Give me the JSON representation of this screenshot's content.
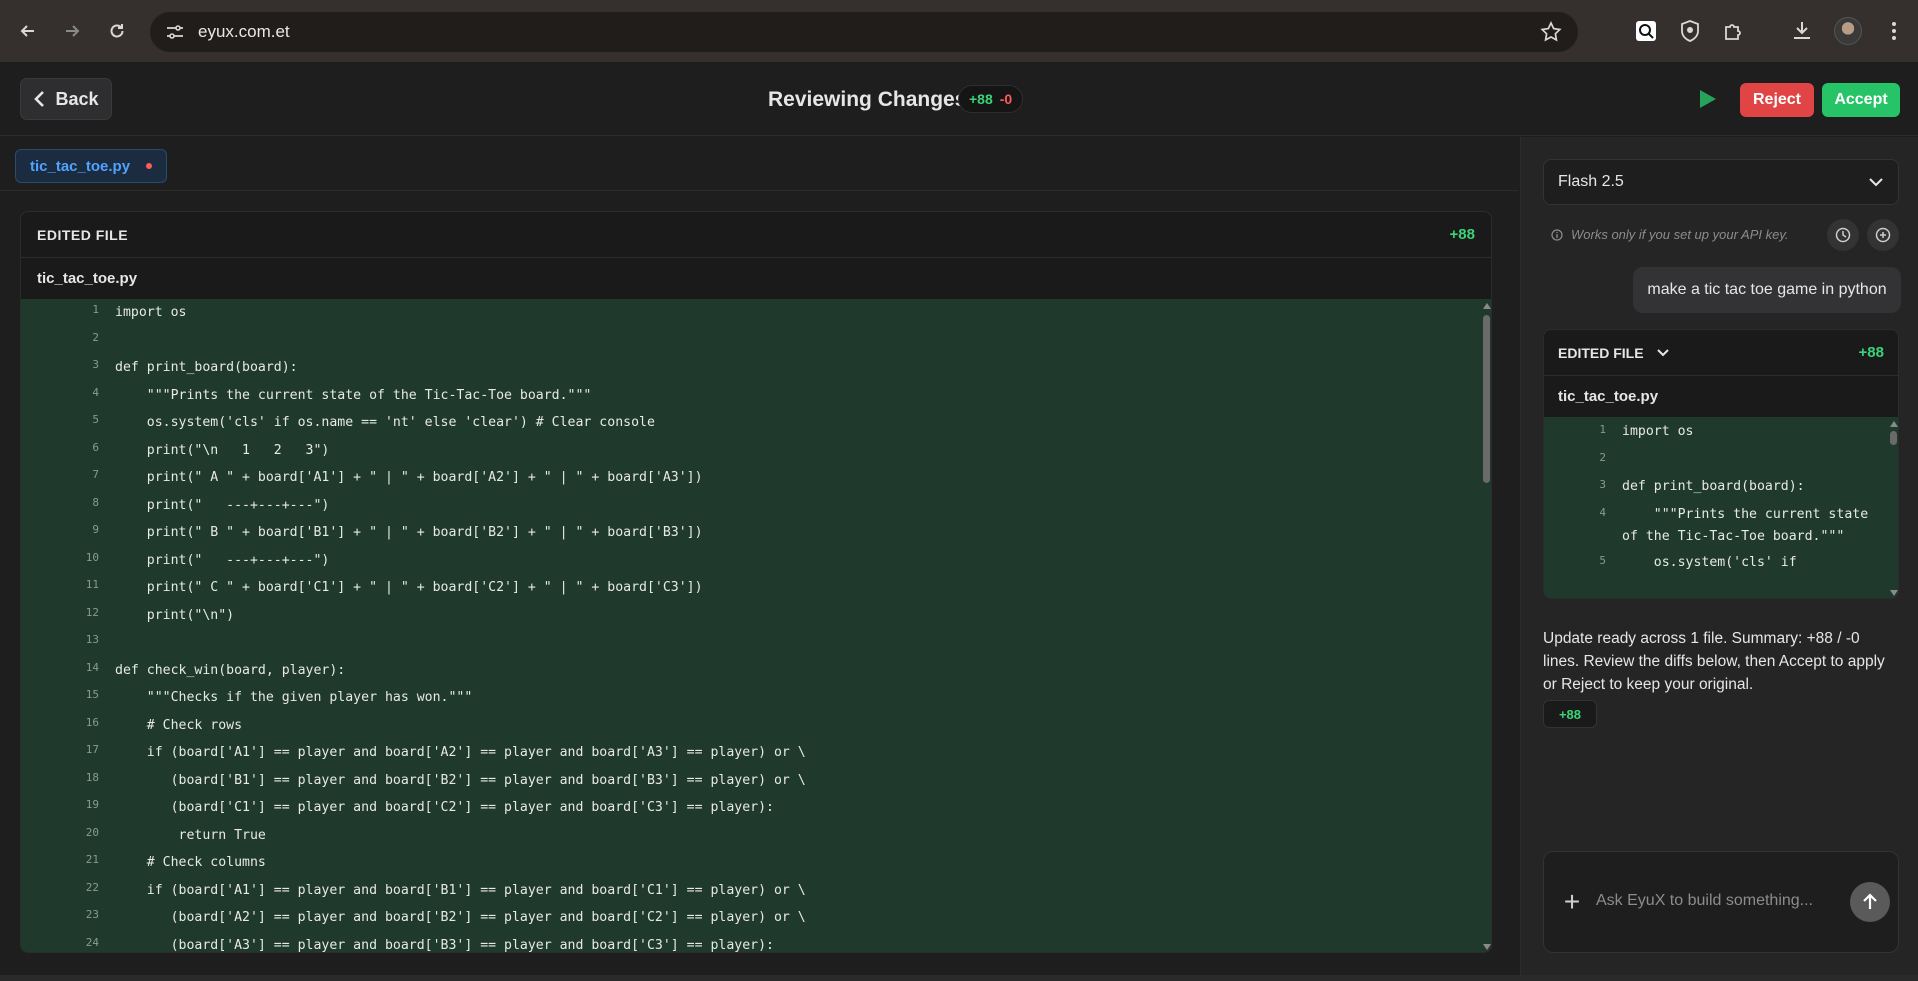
{
  "browser": {
    "url": "eyux.com.et"
  },
  "header": {
    "back_label": "Back",
    "title": "Reviewing Changes",
    "added": "+88",
    "removed": "-0",
    "reject_label": "Reject",
    "accept_label": "Accept"
  },
  "editor": {
    "tab_name": "tic_tac_toe.py",
    "card_label": "EDITED FILE",
    "card_count": "+88",
    "file_name": "tic_tac_toe.py",
    "lines": [
      {
        "n": "1",
        "code": "import os"
      },
      {
        "n": "2",
        "code": ""
      },
      {
        "n": "3",
        "code": "def print_board(board):"
      },
      {
        "n": "4",
        "code": "    \"\"\"Prints the current state of the Tic-Tac-Toe board.\"\"\""
      },
      {
        "n": "5",
        "code": "    os.system('cls' if os.name == 'nt' else 'clear') # Clear console"
      },
      {
        "n": "6",
        "code": "    print(\"\\n   1   2   3\")"
      },
      {
        "n": "7",
        "code": "    print(\" A \" + board['A1'] + \" | \" + board['A2'] + \" | \" + board['A3'])"
      },
      {
        "n": "8",
        "code": "    print(\"   ---+---+---\")"
      },
      {
        "n": "9",
        "code": "    print(\" B \" + board['B1'] + \" | \" + board['B2'] + \" | \" + board['B3'])"
      },
      {
        "n": "10",
        "code": "    print(\"   ---+---+---\")"
      },
      {
        "n": "11",
        "code": "    print(\" C \" + board['C1'] + \" | \" + board['C2'] + \" | \" + board['C3'])"
      },
      {
        "n": "12",
        "code": "    print(\"\\n\")"
      },
      {
        "n": "13",
        "code": ""
      },
      {
        "n": "14",
        "code": "def check_win(board, player):"
      },
      {
        "n": "15",
        "code": "    \"\"\"Checks if the given player has won.\"\"\""
      },
      {
        "n": "16",
        "code": "    # Check rows"
      },
      {
        "n": "17",
        "code": "    if (board['A1'] == player and board['A2'] == player and board['A3'] == player) or \\"
      },
      {
        "n": "18",
        "code": "       (board['B1'] == player and board['B2'] == player and board['B3'] == player) or \\"
      },
      {
        "n": "19",
        "code": "       (board['C1'] == player and board['C2'] == player and board['C3'] == player):"
      },
      {
        "n": "20",
        "code": "        return True"
      },
      {
        "n": "21",
        "code": "    # Check columns"
      },
      {
        "n": "22",
        "code": "    if (board['A1'] == player and board['B1'] == player and board['C1'] == player) or \\"
      },
      {
        "n": "23",
        "code": "       (board['A2'] == player and board['B2'] == player and board['C2'] == player) or \\"
      },
      {
        "n": "24",
        "code": "       (board['A3'] == player and board['B3'] == player and board['C3'] == player):"
      }
    ]
  },
  "panel": {
    "model": "Flash 2.5",
    "api_note": "Works only if you set up your API key.",
    "user_message": "make a tic tac toe game in python",
    "mini_card_label": "EDITED FILE",
    "mini_card_count": "+88",
    "mini_file_name": "tic_tac_toe.py",
    "mini_lines": [
      {
        "n": "1",
        "code": "import os"
      },
      {
        "n": "2",
        "code": ""
      },
      {
        "n": "3",
        "code": "def print_board(board):"
      },
      {
        "n": "4",
        "code": "    \"\"\"Prints the current state of the Tic-Tac-Toe board.\"\"\""
      },
      {
        "n": "5",
        "code": "    os.system('cls' if"
      }
    ],
    "summary": "Update ready across 1 file. Summary: +88 / -0 lines. Review the diffs below, then Accept to apply or Reject to keep your original.",
    "summary_badge": "+88",
    "prompt_placeholder": "Ask EyuX to build something..."
  },
  "colors": {
    "accent_green": "#26c466",
    "accent_red": "#e04444",
    "diff_bg": "#1f3a2c"
  }
}
